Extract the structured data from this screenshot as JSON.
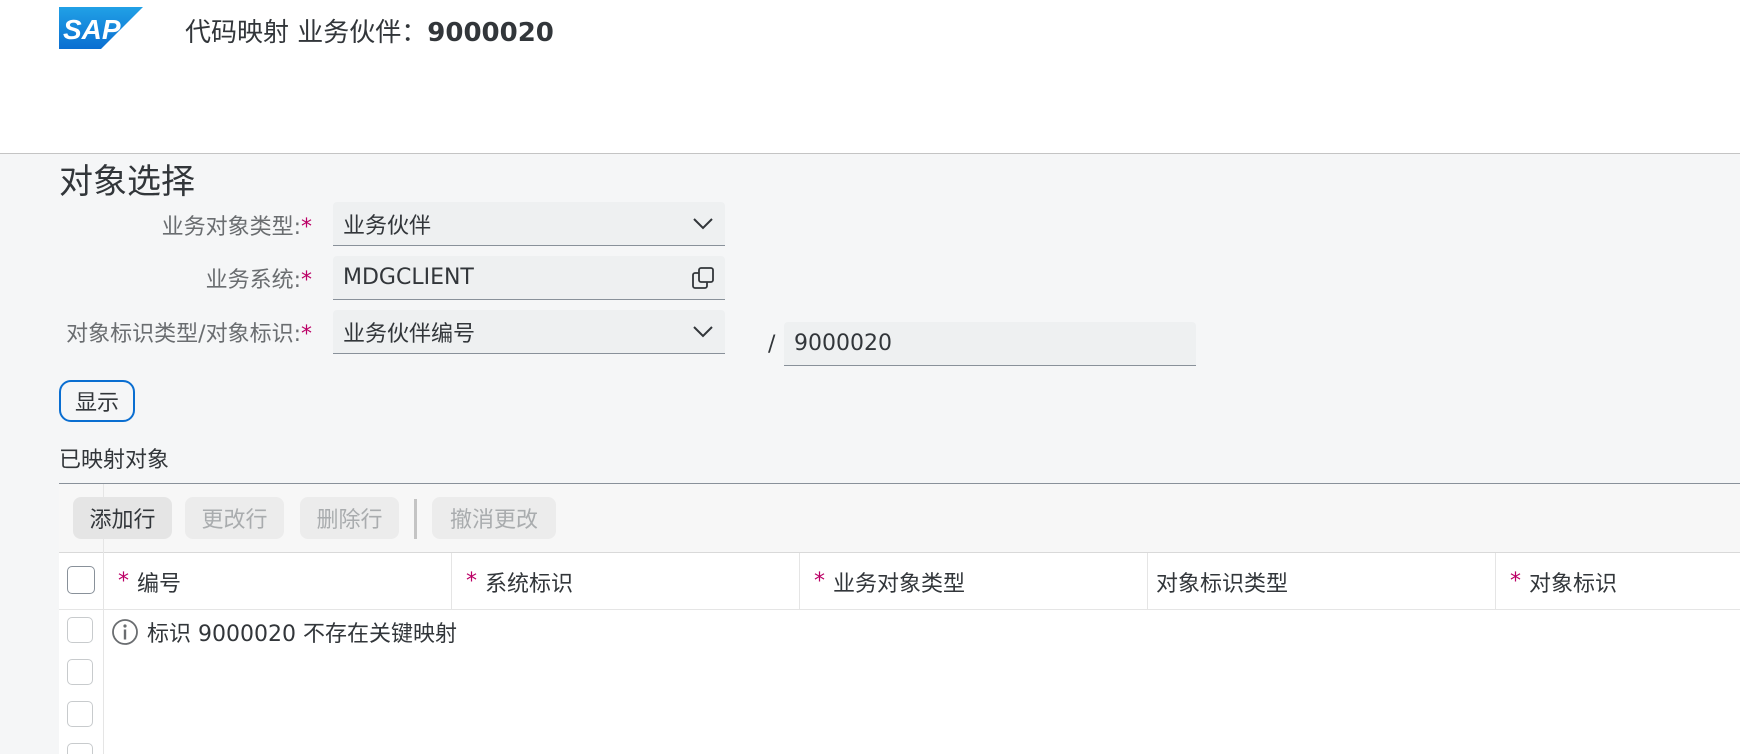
{
  "header": {
    "title_prefix": "代码映射 业务伙伴：",
    "title_id": "9000020",
    "logo_text": "SAP"
  },
  "selection": {
    "section_title": "对象选择",
    "business_object_type": {
      "label": "业务对象类型:",
      "value": "业务伙伴"
    },
    "business_system": {
      "label": "业务系统:",
      "value": "MDGCLIENT"
    },
    "object_id": {
      "label": "对象标识类型/对象标识:",
      "type_value": "业务伙伴编号",
      "separator": "/",
      "id_value": "9000020"
    },
    "required_marker": "*",
    "show_label": "显示"
  },
  "mapped": {
    "title": "已映射对象",
    "toolbar": {
      "add_row": "添加行",
      "change_row": "更改行",
      "delete_row": "删除行",
      "undo": "撤消更改"
    },
    "columns": [
      {
        "label": "编号",
        "required": true
      },
      {
        "label": "系统标识",
        "required": true
      },
      {
        "label": "业务对象类型",
        "required": true
      },
      {
        "label": "对象标识类型",
        "required": false
      },
      {
        "label": "对象标识",
        "required": true
      }
    ],
    "message": "标识 9000020 不存在关键映射"
  },
  "colors": {
    "accent": "#0a6ed1",
    "required": "#bb0066",
    "brand": "#1a8fd6"
  }
}
